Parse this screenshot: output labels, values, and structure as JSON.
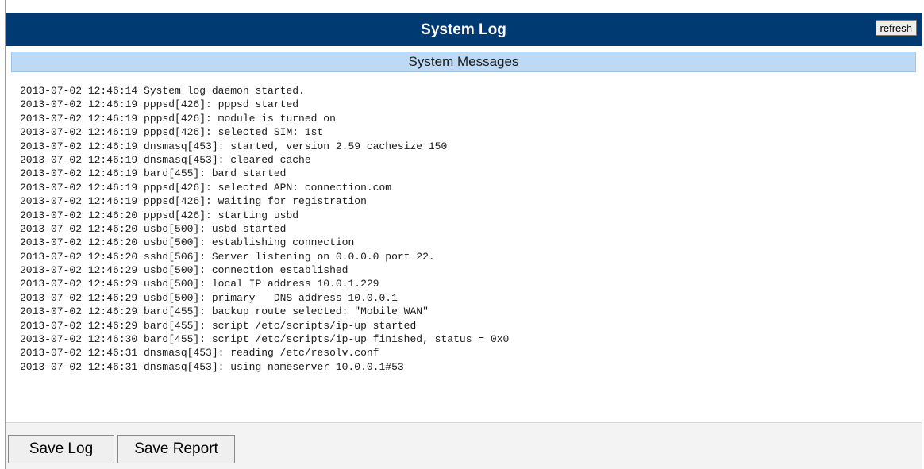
{
  "header": {
    "title": "System Log",
    "refresh_label": "refresh"
  },
  "section": {
    "title": "System Messages"
  },
  "log_lines": [
    "2013-07-02 12:46:14 System log daemon started.",
    "2013-07-02 12:46:19 pppsd[426]: pppsd started",
    "2013-07-02 12:46:19 pppsd[426]: module is turned on",
    "2013-07-02 12:46:19 pppsd[426]: selected SIM: 1st",
    "2013-07-02 12:46:19 dnsmasq[453]: started, version 2.59 cachesize 150",
    "2013-07-02 12:46:19 dnsmasq[453]: cleared cache",
    "2013-07-02 12:46:19 bard[455]: bard started",
    "2013-07-02 12:46:19 pppsd[426]: selected APN: connection.com",
    "2013-07-02 12:46:19 pppsd[426]: waiting for registration",
    "2013-07-02 12:46:20 pppsd[426]: starting usbd",
    "2013-07-02 12:46:20 usbd[500]: usbd started",
    "2013-07-02 12:46:20 usbd[500]: establishing connection",
    "2013-07-02 12:46:20 sshd[506]: Server listening on 0.0.0.0 port 22.",
    "2013-07-02 12:46:29 usbd[500]: connection established",
    "2013-07-02 12:46:29 usbd[500]: local IP address 10.0.1.229",
    "2013-07-02 12:46:29 usbd[500]: primary   DNS address 10.0.0.1",
    "2013-07-02 12:46:29 bard[455]: backup route selected: \"Mobile WAN\"",
    "2013-07-02 12:46:29 bard[455]: script /etc/scripts/ip-up started",
    "2013-07-02 12:46:30 bard[455]: script /etc/scripts/ip-up finished, status = 0x0",
    "2013-07-02 12:46:31 dnsmasq[453]: reading /etc/resolv.conf",
    "2013-07-02 12:46:31 dnsmasq[453]: using nameserver 10.0.0.1#53"
  ],
  "actions": {
    "save_log_label": "Save Log",
    "save_report_label": "Save Report"
  },
  "colors": {
    "titlebar": "#003a73",
    "section_header": "#bcdaf5",
    "actions_background": "#f3f3f3"
  }
}
